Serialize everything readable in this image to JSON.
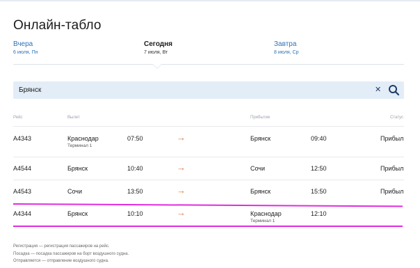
{
  "page": {
    "title": "Онлайн-табло"
  },
  "days": [
    {
      "name": "Вчера",
      "date": "6 июля, Пн"
    },
    {
      "name": "Сегодня",
      "date": "7 июля, Вт"
    },
    {
      "name": "Завтра",
      "date": "8 июля, Ср"
    }
  ],
  "search": {
    "value": "Брянск",
    "clear_icon": "close-icon",
    "search_icon": "search-icon"
  },
  "table": {
    "headers": {
      "flight": "Рейс",
      "departure": "Вылет",
      "arrival": "Прибытие",
      "status": "Статус"
    },
    "rows": [
      {
        "flight": "A4343",
        "from": "Краснодар",
        "from_terminal": "Терминал 1",
        "dep_time": "07:50",
        "arrow": "→",
        "to": "Брянск",
        "to_terminal": "",
        "arr_time": "09:40",
        "status": "Прибыл"
      },
      {
        "flight": "A4544",
        "from": "Брянск",
        "from_terminal": "",
        "dep_time": "10:40",
        "arrow": "→",
        "to": "Сочи",
        "to_terminal": "",
        "arr_time": "12:50",
        "status": "Прибыл"
      },
      {
        "flight": "A4543",
        "from": "Сочи",
        "from_terminal": "",
        "dep_time": "13:50",
        "arrow": "→",
        "to": "Брянск",
        "to_terminal": "",
        "arr_time": "15:50",
        "status": "Прибыл"
      },
      {
        "flight": "A4344",
        "from": "Брянск",
        "from_terminal": "",
        "dep_time": "10:10",
        "arrow": "→",
        "to": "Краснодар",
        "to_terminal": "Терминал 1",
        "arr_time": "12:10",
        "status": ""
      }
    ]
  },
  "notes": [
    "Регистрация — регистрация пассажиров на рейс.",
    "Посадка — посадка пассажиров на борт воздушного судна.",
    "Отправляется — отправление воздушного судна."
  ],
  "colors": {
    "link": "#2d72b8",
    "search_bg": "#e3edf7",
    "arrow": "#e07b3a",
    "highlight": "#e12be0"
  }
}
